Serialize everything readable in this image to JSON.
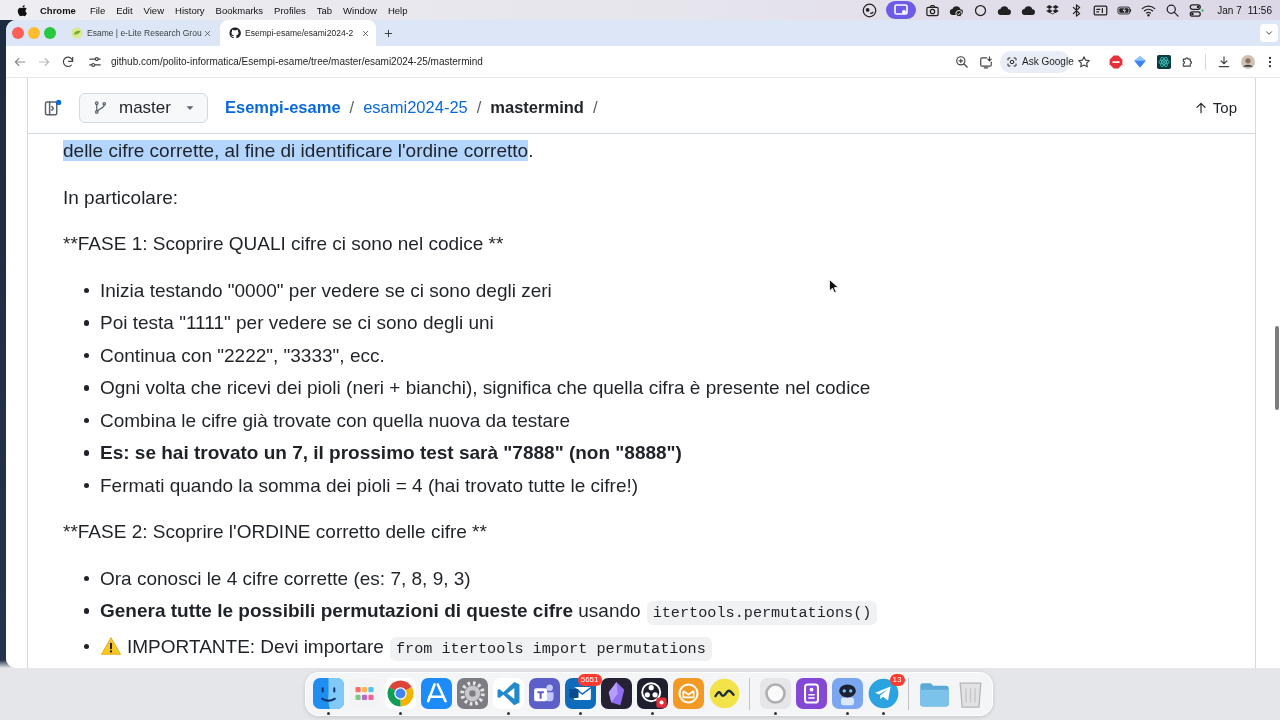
{
  "menu_bar": {
    "app": "Chrome",
    "items": [
      "File",
      "Edit",
      "View",
      "History",
      "Bookmarks",
      "Profiles",
      "Tab",
      "Window",
      "Help"
    ],
    "date": "Jan 7",
    "time": "11:56"
  },
  "tabs": [
    {
      "kind": "leaf",
      "title": "Esame | e-Lite Research Grou",
      "selected": false
    },
    {
      "kind": "cat",
      "title": "Esempi-esame/esami2024-2",
      "selected": true
    }
  ],
  "toolbar": {
    "url": "github.com/polito-informatica/Esempi-esame/tree/master/esami2024-25/mastermind",
    "ask_button": "Ask Google"
  },
  "repo_header": {
    "branch": "master",
    "breadcrumb": [
      {
        "label": "Esempi-esame",
        "kind": "repo",
        "separator": "/"
      },
      {
        "label": "esami2024-25",
        "kind": "folder",
        "separator": "/"
      },
      {
        "label": "mastermind",
        "kind": "current",
        "separator": "/"
      }
    ],
    "top_button": "Top"
  },
  "content": [
    {
      "kind": "paragraph",
      "highlighted": "delle cifre corrette, al fine di identificare l'ordine corretto",
      "text": "."
    },
    {
      "kind": "paragraph",
      "text": "In particolare:"
    },
    {
      "kind": "paragraph",
      "text": "**FASE 1: Scoprire QUALI cifre ci sono nel codice **"
    },
    {
      "kind": "list",
      "items": [
        {
          "text": "Inizia testando \"0000\" per vedere se ci sono degli zeri",
          "bold": false,
          "warning": false
        },
        {
          "text": "Poi testa \"1111\" per vedere se ci sono degli uni",
          "bold": false,
          "warning": false
        },
        {
          "text": "Continua con \"2222\", \"3333\", ecc.",
          "bold": false,
          "warning": false
        },
        {
          "text": "Ogni volta che ricevi dei pioli (neri + bianchi), significa che quella cifra è presente nel codice",
          "bold": false,
          "warning": false
        },
        {
          "text": "Combina le cifre già trovate con quella nuova da testare",
          "bold": false,
          "warning": false
        },
        {
          "text": "Es: se hai trovato un 7, il prossimo test sarà \"7888\" (non \"8888\")",
          "bold": true,
          "warning": false
        },
        {
          "text": "Fermati quando la somma dei pioli = 4 (hai trovato tutte le cifre!)",
          "bold": false,
          "warning": false
        }
      ]
    },
    {
      "kind": "paragraph",
      "text": "**FASE 2: Scoprire l'ORDINE corretto delle cifre **"
    },
    {
      "kind": "list",
      "items": [
        {
          "text": "Ora conosci le 4 cifre corrette (es: 7, 8, 9, 3)",
          "bold": false,
          "warning": false
        },
        {
          "text": "**Genera tutte le possibili permutazioni di queste cifre** usando",
          "code": "itertools.permutations()",
          "bold": false,
          "warning": false
        },
        {
          "text": "IMPORTANTE: Devi importare",
          "code": "from itertools import permutations",
          "bold": false,
          "warning": true
        }
      ]
    }
  ],
  "dock": {
    "sections": [
      {
        "items": [
          {
            "kind": "face",
            "running": true
          },
          {
            "kind": "grid",
            "running": false
          },
          {
            "kind": "wheel",
            "running": true
          },
          {
            "kind": "sticks",
            "running": false
          },
          {
            "kind": "gear",
            "running": false
          },
          {
            "kind": "ribbon",
            "running": true
          },
          {
            "kind": "people",
            "running": false
          },
          {
            "kind": "envelope",
            "running": true,
            "badge": "5651"
          },
          {
            "kind": "crystal",
            "running": false
          },
          {
            "kind": "aperture",
            "running": true
          },
          {
            "kind": "mailring",
            "running": false
          },
          {
            "kind": "wave",
            "running": false
          }
        ]
      },
      {
        "items": [
          {
            "kind": "ring",
            "running": true
          },
          {
            "kind": "device",
            "running": false
          },
          {
            "kind": "robot",
            "running": true
          },
          {
            "kind": "plane",
            "running": true,
            "badge": "13"
          }
        ]
      },
      {
        "items": [
          {
            "kind": "folder",
            "running": false
          },
          {
            "kind": "trash",
            "running": false
          }
        ]
      }
    ]
  }
}
